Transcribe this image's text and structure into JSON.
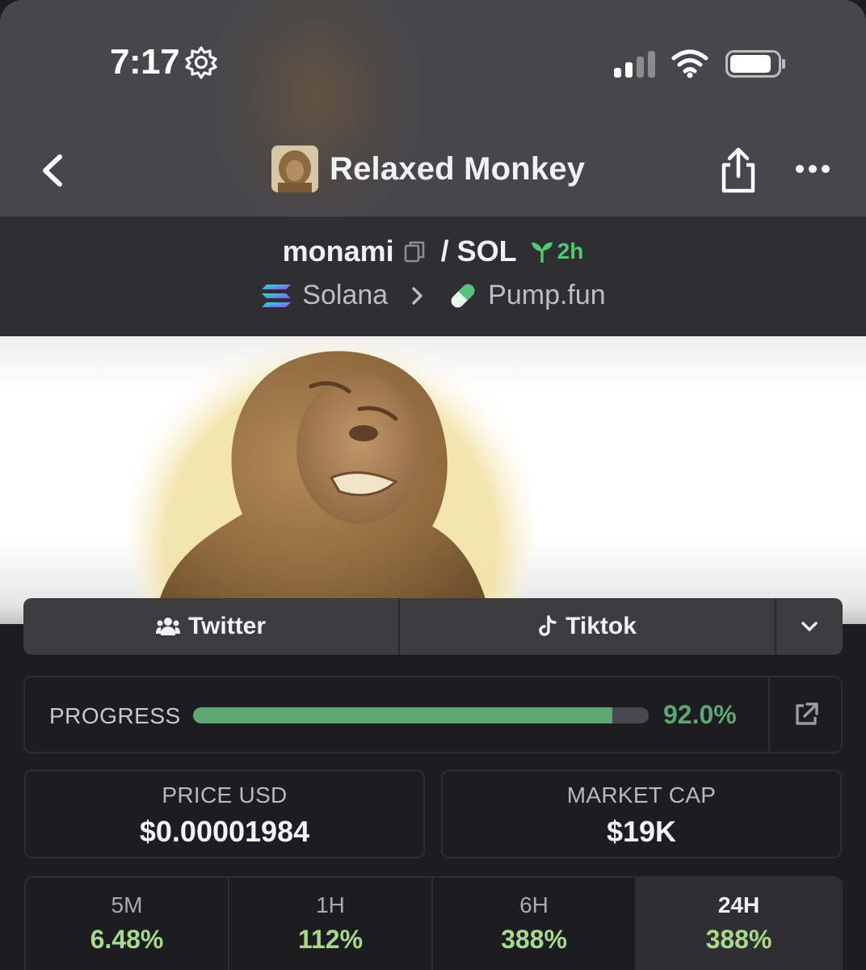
{
  "status_bar": {
    "time": "7:17",
    "icons": [
      "gear-icon",
      "cellular-signal-icon",
      "wifi-icon",
      "battery-icon"
    ]
  },
  "nav": {
    "title": "Relaxed Monkey",
    "back_icon": "chevron-left-icon",
    "share_icon": "share-icon",
    "more_icon": "ellipsis-icon"
  },
  "pair": {
    "base": "monami",
    "separator": "/",
    "quote": "SOL",
    "age": "2h",
    "chain": "Solana",
    "dex": "Pump.fun"
  },
  "socials": [
    {
      "label": "Twitter",
      "icon": "users-icon"
    },
    {
      "label": "Tiktok",
      "icon": "tiktok-icon"
    }
  ],
  "progress": {
    "label": "PROGRESS",
    "value_text": "92.0%",
    "fraction": 0.92
  },
  "stats": {
    "price": {
      "label": "PRICE USD",
      "value": "$0.00001984"
    },
    "market_cap": {
      "label": "MARKET CAP",
      "value": "$19K"
    }
  },
  "timeframes": [
    {
      "label": "5M",
      "value": "6.48%"
    },
    {
      "label": "1H",
      "value": "112%"
    },
    {
      "label": "6H",
      "value": "388%"
    },
    {
      "label": "24H",
      "value": "388%",
      "selected": true
    }
  ],
  "colors": {
    "accent_green": "#5ea775",
    "change_green": "#a7d98a",
    "age_green": "#4ecb71",
    "background": "#1c1c21",
    "header": "#47474b"
  }
}
